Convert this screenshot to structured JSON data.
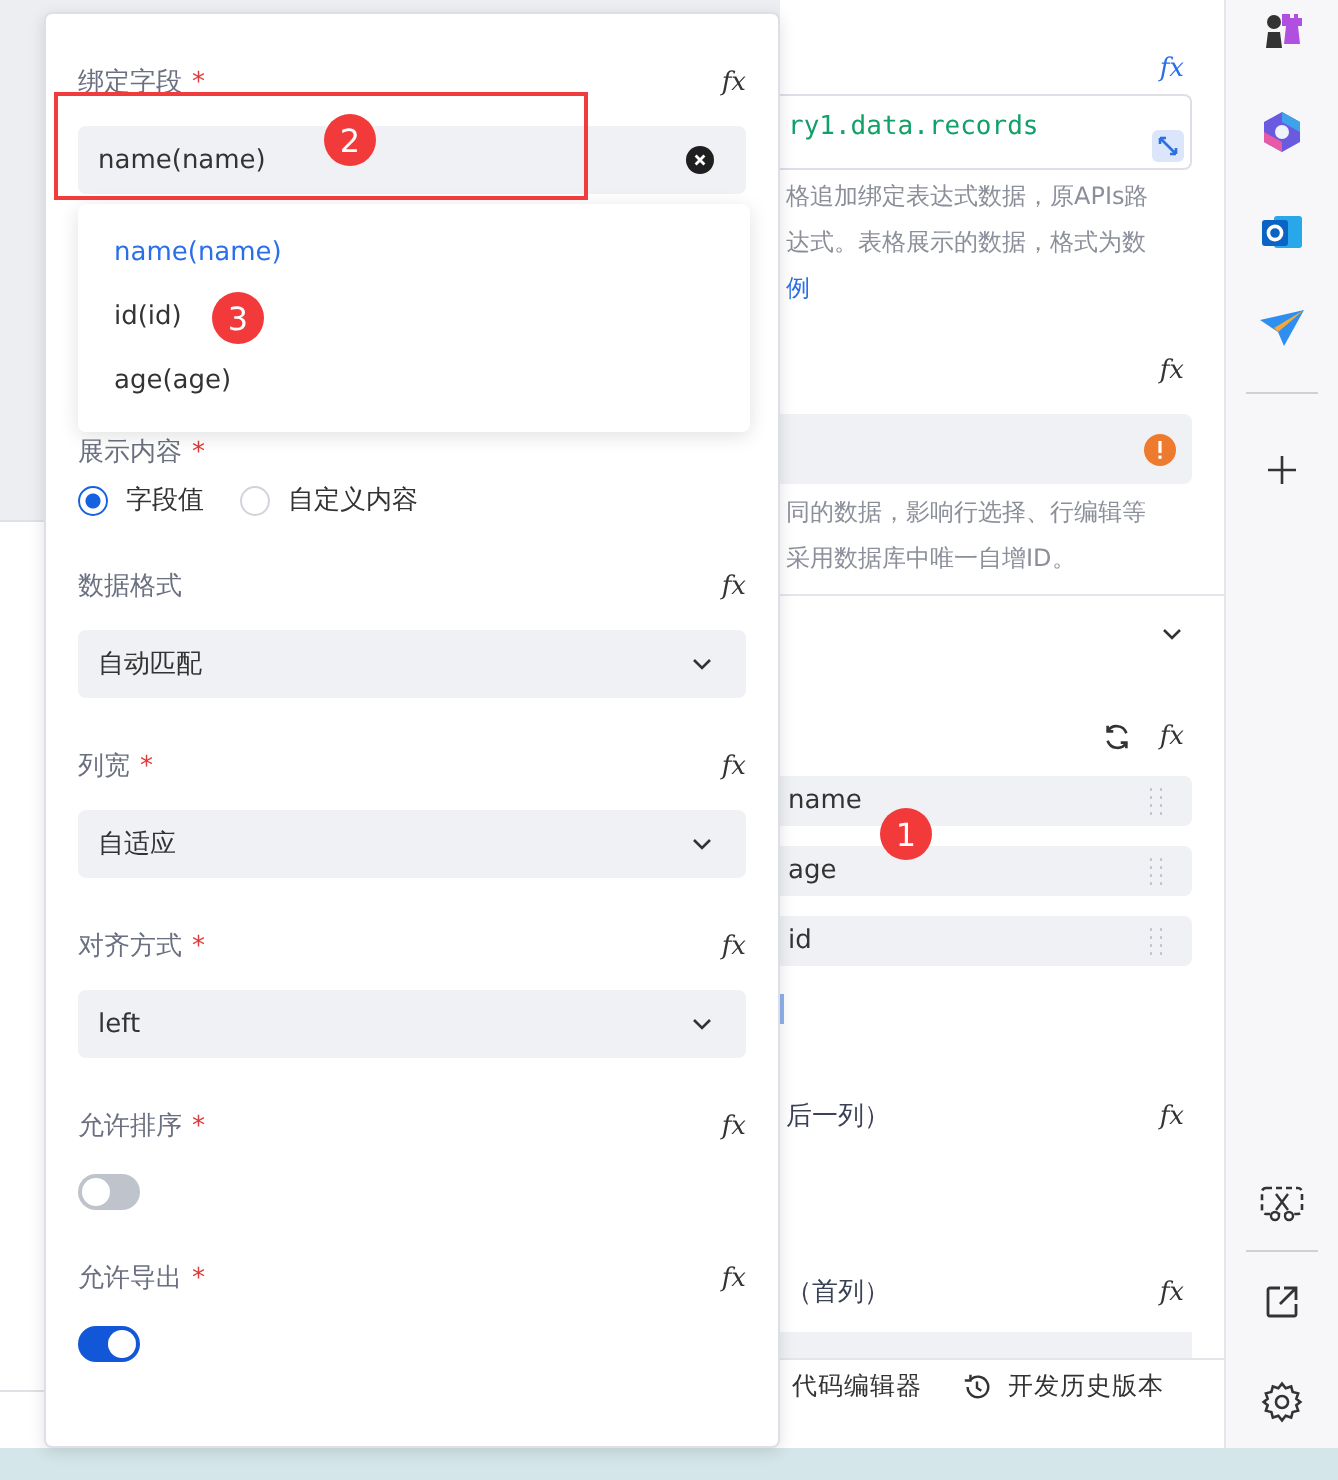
{
  "popover": {
    "bind_field": {
      "label": "绑定字段",
      "required_mark": "*",
      "formula": "fx",
      "value": "name(name)",
      "clearable": true,
      "options": [
        {
          "label": "name(name)",
          "selected": true
        },
        {
          "label": "id(id)",
          "selected": false
        },
        {
          "label": "age(age)",
          "selected": false
        }
      ]
    },
    "display_content": {
      "label": "展示内容",
      "required_mark": "*",
      "radios": [
        {
          "label": "字段值",
          "selected": true
        },
        {
          "label": "自定义内容",
          "selected": false
        }
      ]
    },
    "settings": [
      {
        "kind": "select",
        "label": "数据格式",
        "formula": "fx",
        "value": "自动匹配"
      },
      {
        "kind": "select",
        "label": "列宽",
        "required_mark": "*",
        "formula": "fx",
        "value": "自适应"
      },
      {
        "kind": "select",
        "label": "对齐方式",
        "required_mark": "*",
        "formula": "fx",
        "value": "left"
      },
      {
        "kind": "switch",
        "label": "允许排序",
        "required_mark": "*",
        "formula": "fx",
        "on": false
      },
      {
        "kind": "switch",
        "label": "允许导出",
        "required_mark": "*",
        "formula": "fx",
        "on": true
      }
    ]
  },
  "right_panel": {
    "formula_icons": [
      "fx",
      "fx",
      "fx",
      "fx",
      "fx"
    ],
    "expression": "ry1.data.records",
    "help_lines": [
      "格追加绑定表达式数据，原APIs路",
      "达式。表格展示的数据，格式为数"
    ],
    "help_link": "例",
    "key_help_lines": [
      "同的数据，影响行选择、行编辑等",
      "采用数据库中唯一自增ID。"
    ],
    "columns": [
      "name",
      "age",
      "id"
    ],
    "last_column_label": "后一列）",
    "first_column_label": "（首列）"
  },
  "footer": [
    {
      "label": "代码编辑器"
    },
    {
      "label": "开发历史版本"
    }
  ],
  "annotations": [
    {
      "text": "1"
    },
    {
      "text": "2"
    },
    {
      "text": "3"
    }
  ]
}
